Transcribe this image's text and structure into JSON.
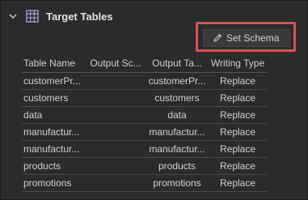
{
  "section": {
    "title": "Target Tables",
    "expanded_icon": "chevron-down-icon",
    "table_icon": "table-grid-icon"
  },
  "toolbar": {
    "set_schema_label": "Set Schema",
    "set_schema_icon": "pencil-icon"
  },
  "table": {
    "columns": [
      "Table Name",
      "Output Sc...",
      "Output Ta...",
      "Writing Type"
    ],
    "rows": [
      [
        "customerPr...",
        "",
        "customerPr...",
        "Replace"
      ],
      [
        "customers",
        "",
        "customers",
        "Replace"
      ],
      [
        "data",
        "",
        "data",
        "Replace"
      ],
      [
        "manufactur...",
        "",
        "manufactur...",
        "Replace"
      ],
      [
        "manufactur...",
        "",
        "manufactur...",
        "Replace"
      ],
      [
        "products",
        "",
        "products",
        "Replace"
      ],
      [
        "promotions",
        "",
        "promotions",
        "Replace"
      ]
    ]
  },
  "colors": {
    "background": "#2b2b2b",
    "highlight": "#d9534f",
    "button_bg": "#3a3a3a"
  }
}
